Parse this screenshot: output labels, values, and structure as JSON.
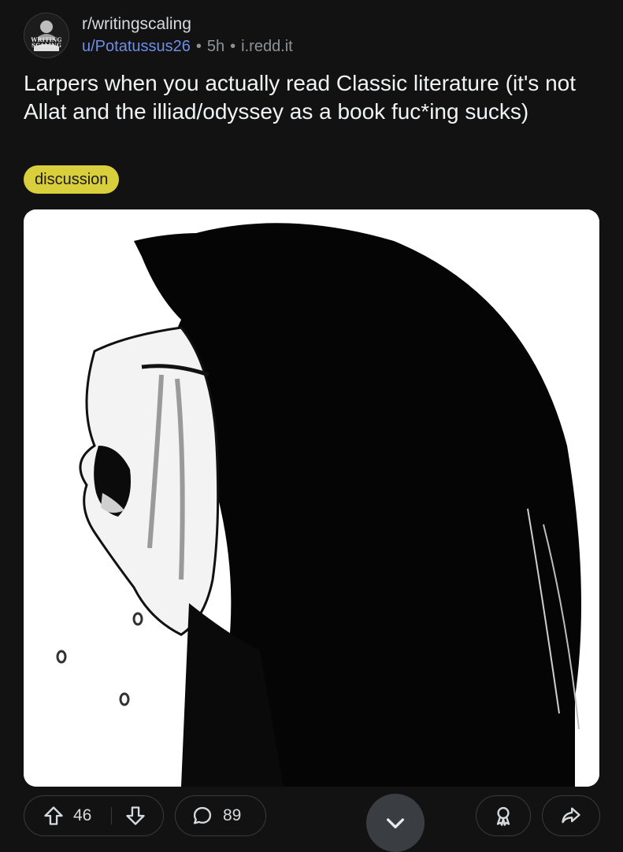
{
  "post": {
    "subreddit": "r/writingscaling",
    "username": "u/Potatussus26",
    "age": "5h",
    "domain": "i.redd.it",
    "separator": "•",
    "title": "Larpers when you actually read Classic literature (it's not Allat and the illiad/odyssey as a book fuc*ing sucks)",
    "flair": "discussion",
    "avatar_logo_text": [
      "WRITING",
      "SCALING"
    ]
  },
  "actions": {
    "upvotes": "46",
    "comments": "89"
  },
  "icons": {
    "upvote": "upvote-arrow-icon",
    "downvote": "downvote-arrow-icon",
    "comment": "comment-bubble-icon",
    "award": "award-icon",
    "share": "share-icon",
    "scroll": "chevron-down-icon"
  },
  "colors": {
    "background": "#121212",
    "flair": "#d9cf3d",
    "username": "#6f8ee6"
  }
}
